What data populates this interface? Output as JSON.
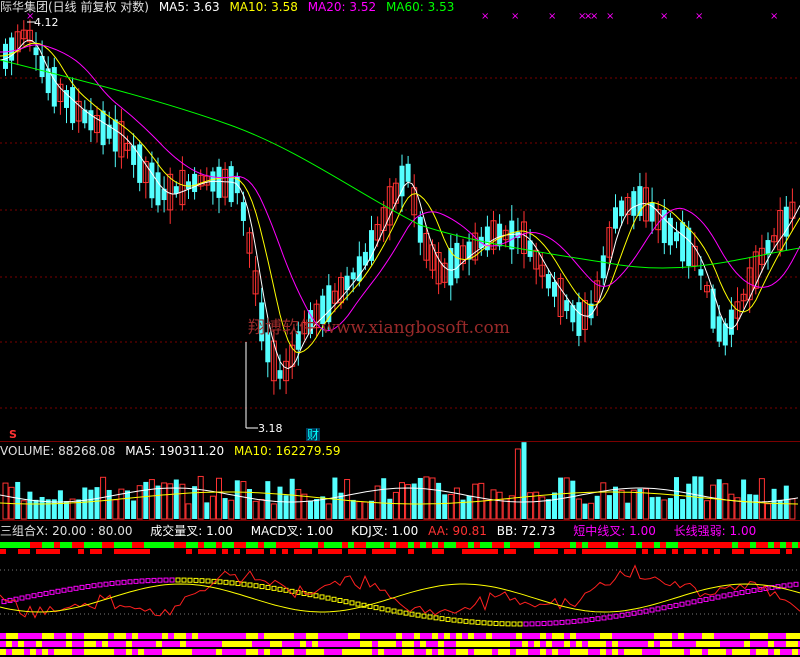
{
  "main_header": {
    "title": "际华集团(日线 前复权 对数)",
    "ma5_label": "MA5: 3.63",
    "ma10_label": "MA10: 3.58",
    "ma20_label": "MA20: 3.52",
    "ma60_label": "MA60: 3.53"
  },
  "main_chart": {
    "high_label": "4.12",
    "low_label": "3.18",
    "watermark": "翔博软件 www.xiangbosoft.com",
    "cai_marker": "财",
    "s_marker": "S"
  },
  "volume_header": {
    "volume_label": "VOLUME: 88268.08",
    "ma5_label": "MA5: 190311.20",
    "ma10_label": "MA10: 162279.59"
  },
  "indicator_header": {
    "zuhe_label": "三组合X: 20.00 : 80.00",
    "chengjiao_label": "成交量叉: 1.00",
    "macd_label": "MACD叉: 1.00",
    "kdj_label": "KDJ叉: 1.00",
    "aa_label": "AA: 90.81",
    "bb_label": "BB: 72.73",
    "duanzhong_label": "短中线叉: 1.00",
    "changxian_label": "长线强弱: 1.00"
  },
  "colors": {
    "up": "#ff3232",
    "down": "#54ffff",
    "ma5": "#ffffff",
    "ma10": "#ffff00",
    "ma20": "#ff00ff",
    "ma60": "#00ff00"
  }
}
